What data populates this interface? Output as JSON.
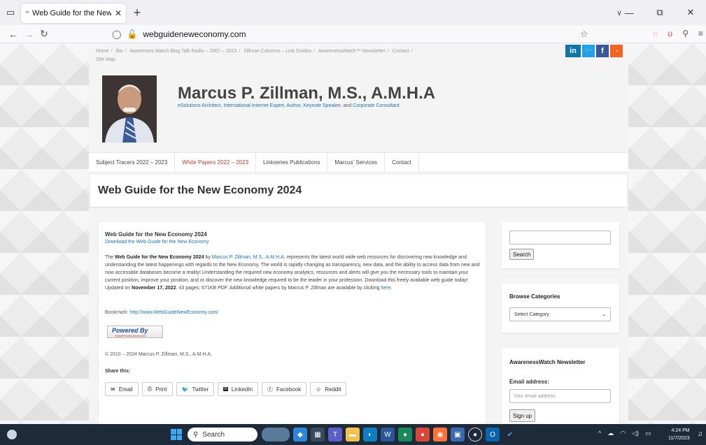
{
  "browser": {
    "tab_title": "Web Guide for the New Economy",
    "tab_favicon": "**",
    "new_tab": "+",
    "tabs_dropdown": "∨",
    "window_minimize": "—",
    "window_restore": "⧉",
    "window_close": "✕",
    "url": "webguideneweconomy.com"
  },
  "site": {
    "breadcrumb_links": [
      "Home",
      "Bio",
      "Awareness Watch Blog Talk Radio – 2007 – 2023",
      "Zillman Columns – Link Guides",
      "AwarenessWatch™ Newsletter",
      "Contact",
      "Site Map"
    ],
    "social": [
      "in",
      "🐦",
      "f",
      "rss"
    ],
    "title": "Marcus P. Zillman, M.S., A.M.H.A",
    "tagline_parts": [
      "eSolutions Architect, International Internet Expert, Author, Keynote Speaker,",
      "and",
      "Corporate Consultant"
    ],
    "menu": [
      "Subject Tracers 2022 – 2023",
      "White Papers 2022 – 2023",
      "Linkseries Publications",
      "Marcus' Services",
      "Contact"
    ],
    "page_title": "Web Guide for the New Economy 2024"
  },
  "article": {
    "heading": "Web Guide for the New Economy 2024",
    "download_link": "Download the Web Guide for the New Economy",
    "body_1": "The",
    "body_bold": "Web Guide for the New Economy 2024",
    "body_2": "by",
    "body_author": "Marcus P. Zillman, M.S., A.M.H.A.",
    "body_3": "represents the latest world wide web resources for discovering new knowledge and understanding the latest happenings with regards to the New Economy. The world is rapidly changing as transparency, new data, and the ability to access data from new and now accessible databases become a reality! Understanding the required new economy analytics, resources and alerts will give you the necessary tools to maintain your current position, improve your position, and or discover the new knowledge required to be the leader in your profession. Download this freely available web guide today! Updated on",
    "body_date": "November 17, 2022",
    "body_4": ". 43 pages; 671KB PDF. Additional white papers by Marcus P. Zillman are available by clicking",
    "body_here": "here",
    "bookmark_label": "Bookmark:",
    "bookmark_url": "http://www.WebGuideNewEconomy.com/",
    "powered_by": "Powered By",
    "powered_sub": "VirtualPrivateLibrary.com",
    "copyright": "© 2010 – 2024 Marcus P. Zillman, M.S., A.M.H.A.",
    "share_label": "Share this:",
    "share_buttons": [
      "Email",
      "Print",
      "Twitter",
      "LinkedIn",
      "Facebook",
      "Reddit"
    ]
  },
  "sidebar": {
    "search_button": "Search",
    "categories_title": "Browse Categories",
    "category_select": "Select Category",
    "newsletter_title": "AwarenessWatch Newsletter",
    "email_label": "Email address:",
    "email_placeholder": "Your email address",
    "signup_button": "Sign up"
  },
  "taskbar": {
    "search_placeholder": "Search",
    "time": "4:24 PM",
    "date": "11/7/2023"
  }
}
